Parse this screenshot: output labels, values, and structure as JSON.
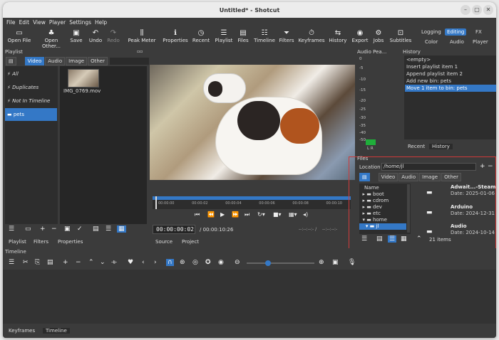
{
  "window": {
    "title": "Untitled* - Shotcut"
  },
  "menu": [
    "File",
    "Edit",
    "View",
    "Player",
    "Settings",
    "Help"
  ],
  "toolbar": [
    {
      "label": "Open File",
      "icon": "open-file-icon"
    },
    {
      "label": "Open Other...",
      "icon": "open-other-icon"
    },
    {
      "label": "Save",
      "icon": "save-icon"
    },
    {
      "label": "Undo",
      "icon": "undo-icon"
    },
    {
      "label": "Redo",
      "icon": "redo-icon",
      "disabled": true
    },
    {
      "label": "Peak Meter",
      "icon": "peak-meter-icon"
    },
    {
      "label": "Properties",
      "icon": "properties-icon"
    },
    {
      "label": "Recent",
      "icon": "recent-icon"
    },
    {
      "label": "Playlist",
      "icon": "playlist-icon"
    },
    {
      "label": "Files",
      "icon": "files-icon"
    },
    {
      "label": "Timeline",
      "icon": "timeline-icon"
    },
    {
      "label": "Filters",
      "icon": "filters-icon"
    },
    {
      "label": "Keyframes",
      "icon": "keyframes-icon"
    },
    {
      "label": "History",
      "icon": "history-icon"
    },
    {
      "label": "Export",
      "icon": "export-icon"
    },
    {
      "label": "Jobs",
      "icon": "jobs-icon"
    },
    {
      "label": "Subtitles",
      "icon": "subtitles-icon"
    }
  ],
  "layouts": {
    "top": [
      "Logging",
      "Editing",
      "FX"
    ],
    "bottom": [
      "Color",
      "Audio",
      "Player"
    ],
    "active": "Editing"
  },
  "playlist": {
    "title": "Playlist",
    "tabs": [
      "Video",
      "Audio",
      "Image",
      "Other"
    ],
    "bins": [
      "All",
      "Duplicates",
      "Not In Timeline",
      "pets"
    ],
    "selected_bin": "pets",
    "clip": "IMG_0769.mov",
    "bottom_tabs": [
      "Playlist",
      "Filters",
      "Properties"
    ]
  },
  "player": {
    "timecode": "00:00:00:02",
    "duration": "/ 00:00:10:26",
    "in_out_left": "--:--:--:- /",
    "in_out_right": "--:--:--:-",
    "ruler": [
      "00:00:00",
      "00:00:02",
      "00:00:04",
      "00:00:06",
      "00:00:08",
      "00:00:10"
    ],
    "tabs": [
      "Source",
      "Project"
    ]
  },
  "audio": {
    "title": "Audio Pea...",
    "scale": [
      "0",
      "-5",
      "-10",
      "-15",
      "-20",
      "-25",
      "-30",
      "-35",
      "-40",
      "-50"
    ],
    "lr": "L R"
  },
  "history": {
    "title": "History",
    "items": [
      "<empty>",
      "Insert playlist item 1",
      "Append playlist item 2",
      "Add new bin: pets",
      "Move 1 item to bin: pets"
    ],
    "selected": 4,
    "tabs": [
      "Recent",
      "History"
    ]
  },
  "files": {
    "title": "Files",
    "location_label": "Location",
    "location": "/home/jl",
    "tabs": [
      "Video",
      "Audio",
      "Image",
      "Other"
    ],
    "tree_header": "Name",
    "tree": [
      "boot",
      "cdrom",
      "dev",
      "etc",
      "home",
      "jl"
    ],
    "tree_selected": "jl",
    "entries": [
      {
        "name": "Adwait...-Steam",
        "date": "Date: 2025-01-06"
      },
      {
        "name": "Arduino",
        "date": "Date: 2024-12-31"
      },
      {
        "name": "Audio",
        "date": "Date: 2024-10-14"
      }
    ],
    "count": "21 items"
  },
  "timeline": {
    "title": "Timeline",
    "tabs": [
      "Keyframes",
      "Timeline"
    ]
  }
}
